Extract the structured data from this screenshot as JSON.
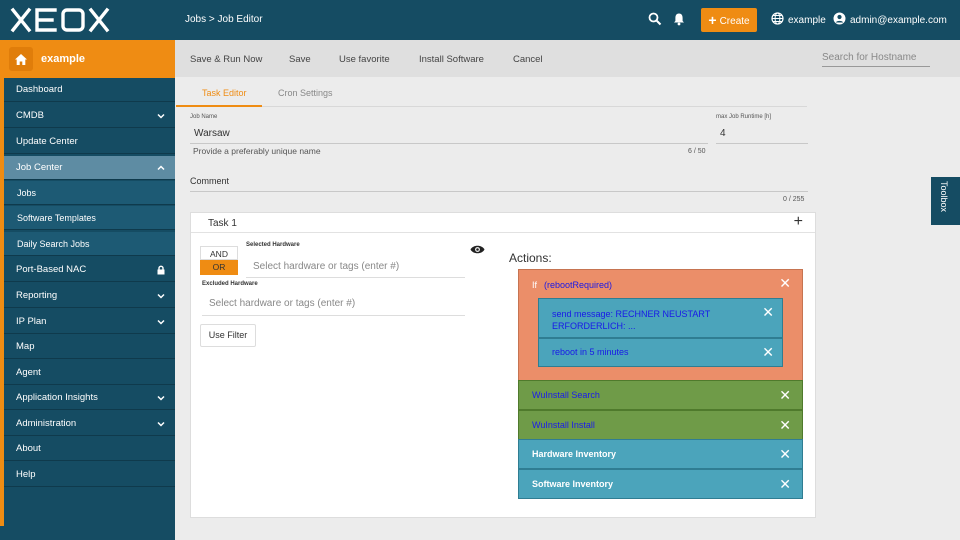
{
  "app": {
    "logo_text": "XEOX",
    "breadcrumb": "Jobs > Job Editor",
    "create_label": "Create",
    "tenant_label": "example",
    "user_label": "admin@example.com"
  },
  "sidebar": {
    "home_label": "example",
    "items": [
      {
        "label": "Dashboard"
      },
      {
        "label": "CMDB"
      },
      {
        "label": "Update Center"
      },
      {
        "label": "Job Center"
      },
      {
        "label": "Jobs"
      },
      {
        "label": "Software Templates"
      },
      {
        "label": "Daily Search Jobs"
      },
      {
        "label": "Port-Based NAC"
      },
      {
        "label": "Reporting"
      },
      {
        "label": "IP Plan"
      },
      {
        "label": "Map"
      },
      {
        "label": "Agent"
      },
      {
        "label": "Application Insights"
      },
      {
        "label": "Administration"
      },
      {
        "label": "About"
      },
      {
        "label": "Help"
      }
    ]
  },
  "toolbar": {
    "save_run_label": "Save & Run Now",
    "save_label": "Save",
    "use_favorite_label": "Use favorite",
    "install_software_label": "Install Software",
    "cancel_label": "Cancel",
    "search_placeholder": "Search for Hostname"
  },
  "tabs": {
    "task_editor": "Task Editor",
    "cron_settings": "Cron Settings"
  },
  "form": {
    "job_name_label": "Job Name",
    "job_name_value": "Warsaw",
    "job_name_hint": "Provide a preferably unique name",
    "job_name_counter": "6 / 50",
    "max_runtime_label": "max Job Runtime [h]",
    "max_runtime_value": "4",
    "comment_label": "Comment",
    "comment_counter": "0 / 255"
  },
  "task": {
    "title": "Task 1",
    "and_label": "AND",
    "or_label": "OR",
    "selected_hw_label": "Selected Hardware",
    "selected_hw_placeholder": "Select hardware or tags (enter #)",
    "excluded_hw_label": "Excluded Hardware",
    "excluded_hw_placeholder": "Select hardware or tags (enter #)",
    "use_filter_label": "Use Filter",
    "actions_label": "Actions:",
    "if_label": "If",
    "if_condition": "(rebootRequired)",
    "inner_actions": [
      {
        "label": "send message: RECHNER NEUSTART ERFORDERLICH: ..."
      },
      {
        "label": "reboot in 5 minutes"
      }
    ],
    "actions": [
      {
        "label": "WuInstall Search",
        "color": "#6f9b48"
      },
      {
        "label": "WuInstall Install",
        "color": "#6f9b48"
      },
      {
        "label": "Hardware Inventory",
        "color": "#4ba4bb"
      },
      {
        "label": "Software Inventory",
        "color": "#4ba4bb"
      }
    ]
  },
  "toolbox_label": "Toolbox",
  "colors": {
    "primary": "#154c63",
    "accent": "#ef8c13",
    "if_block": "#eb8e69"
  }
}
